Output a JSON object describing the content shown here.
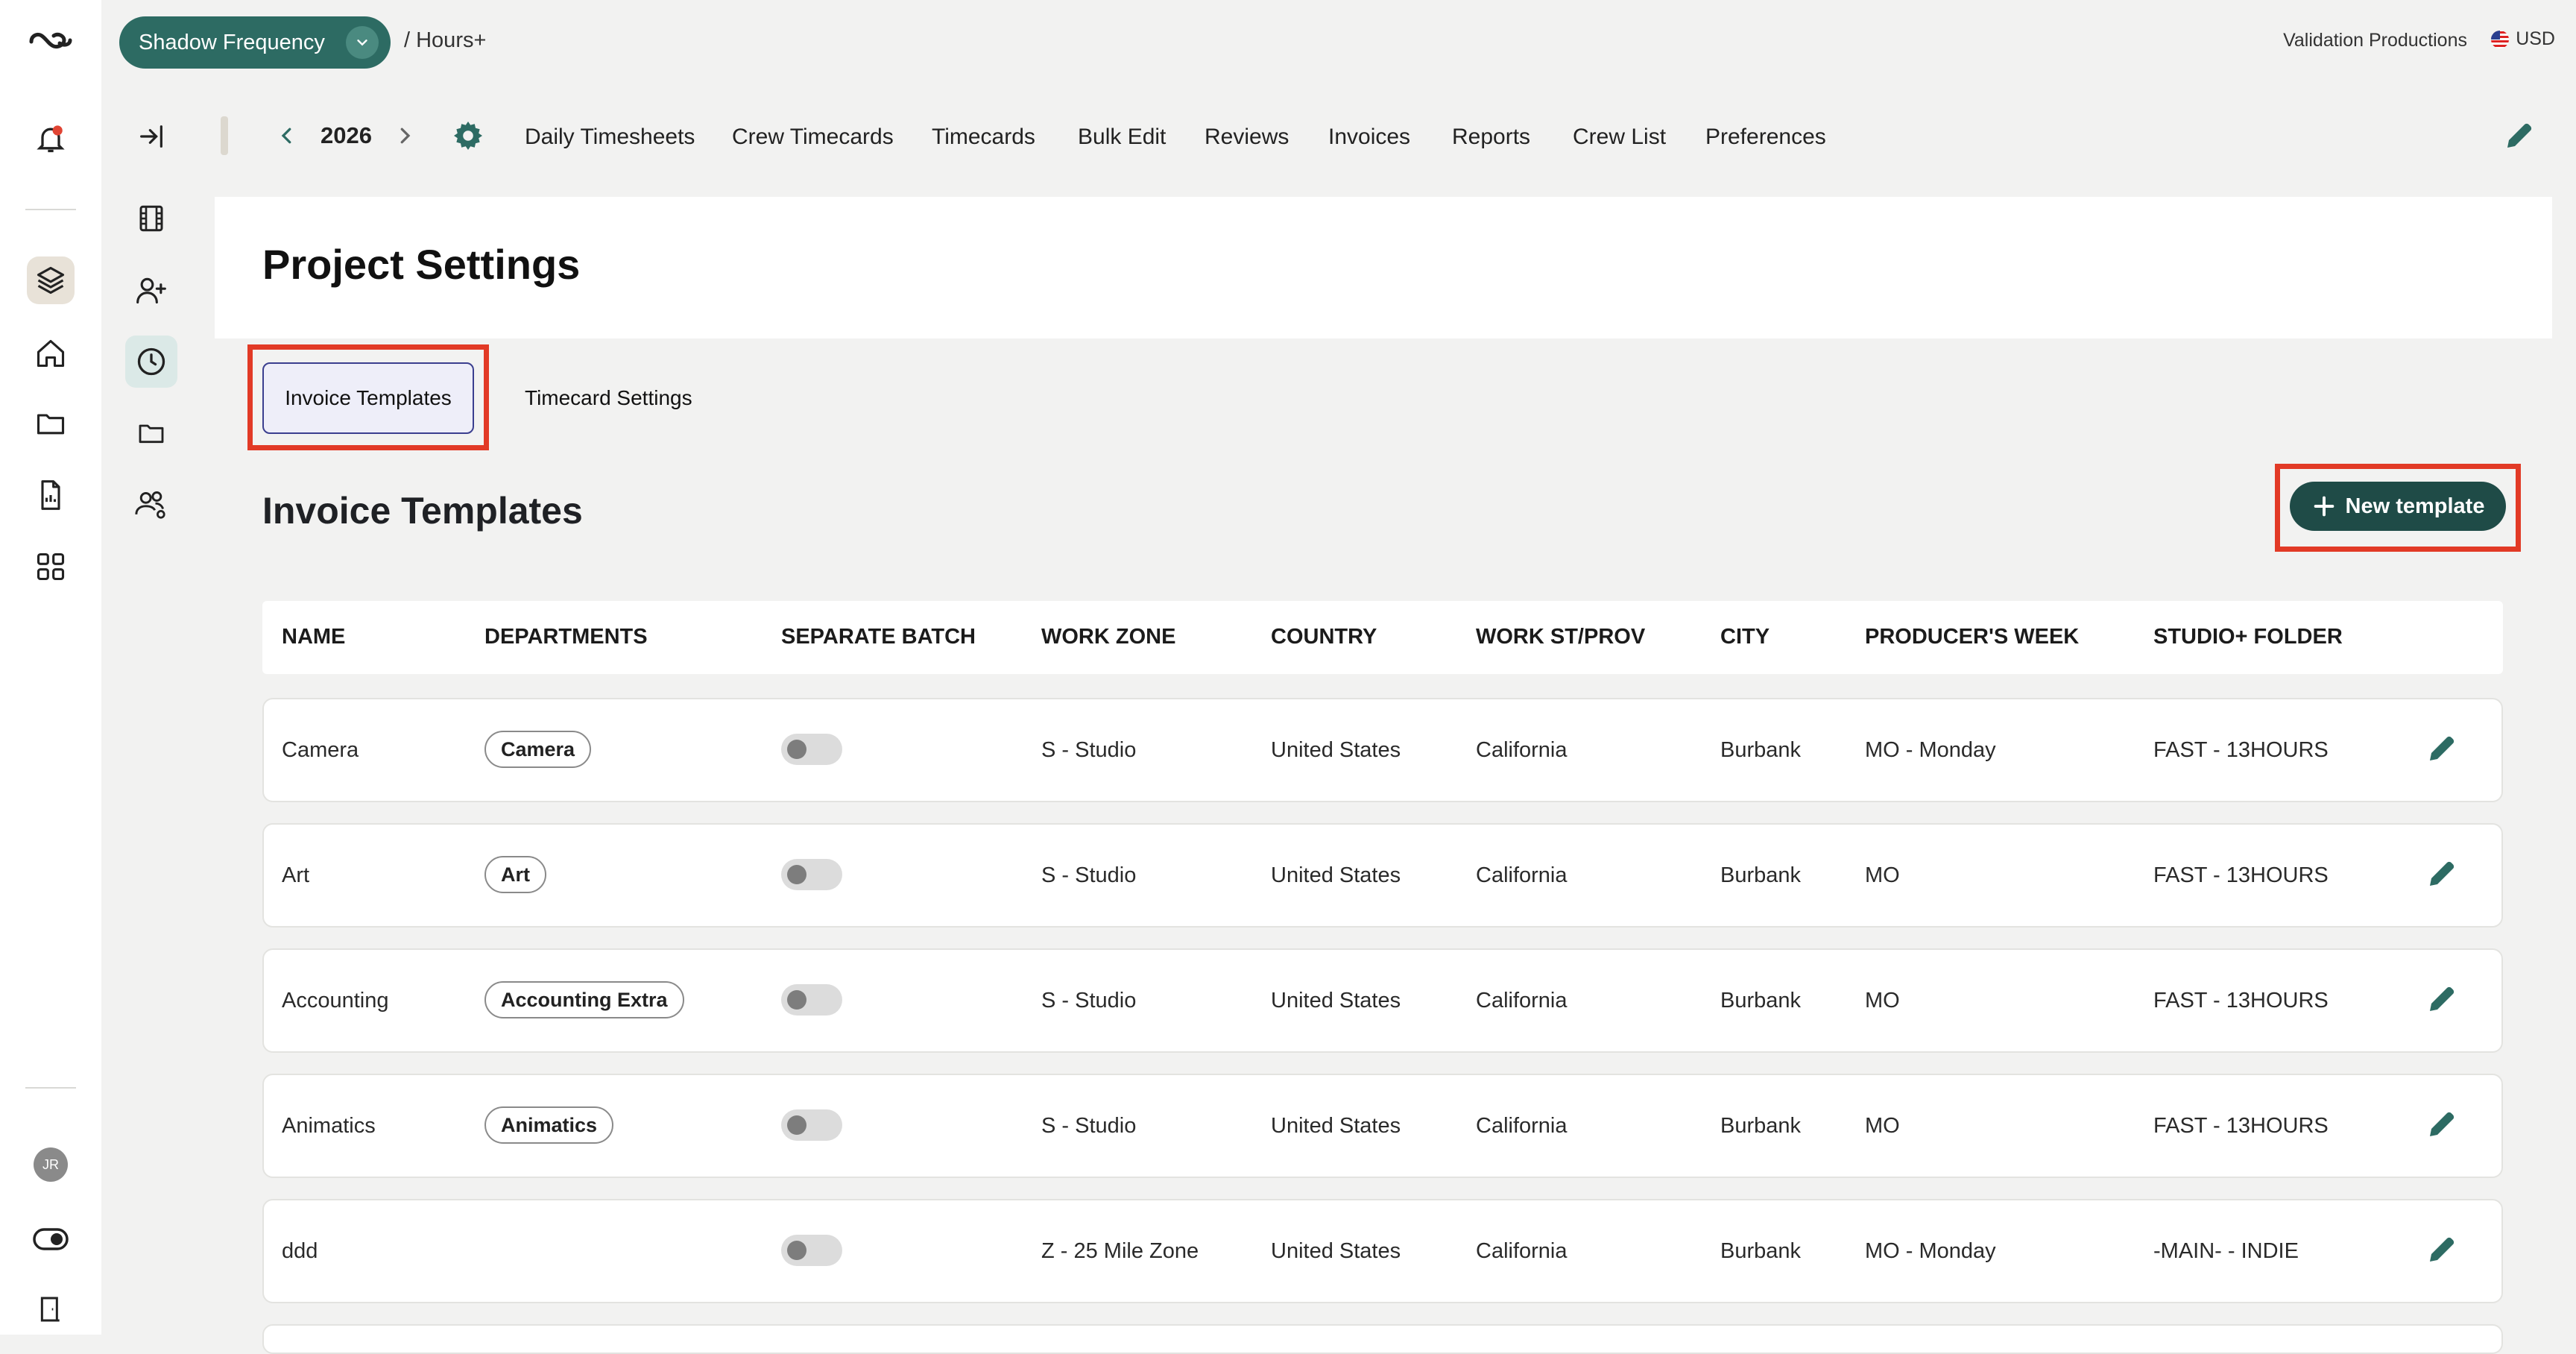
{
  "app": {
    "project_name": "Shadow Frequency",
    "breadcrumb": "/ Hours+",
    "organization": "Validation Productions",
    "currency": "USD"
  },
  "nav": {
    "year": "2026",
    "items": [
      "Daily Timesheets",
      "Crew Timecards",
      "Timecards",
      "Bulk Edit",
      "Reviews",
      "Invoices",
      "Reports",
      "Crew List",
      "Preferences"
    ]
  },
  "rail": {
    "avatar_initials": "JR"
  },
  "page": {
    "title": "Project Settings",
    "tabs": [
      "Invoice Templates",
      "Timecard Settings"
    ],
    "section_title": "Invoice Templates",
    "new_button": "New template"
  },
  "table": {
    "headers": [
      "NAME",
      "DEPARTMENTS",
      "SEPARATE BATCH",
      "WORK ZONE",
      "COUNTRY",
      "WORK ST/PROV",
      "CITY",
      "PRODUCER'S WEEK",
      "STUDIO+ FOLDER"
    ],
    "rows": [
      {
        "name": "Camera",
        "department": "Camera",
        "separate_batch": false,
        "work_zone": "S - Studio",
        "country": "United States",
        "state": "California",
        "city": "Burbank",
        "producers_week": "MO - Monday",
        "folder": "FAST - 13HOURS"
      },
      {
        "name": "Art",
        "department": "Art",
        "separate_batch": false,
        "work_zone": "S - Studio",
        "country": "United States",
        "state": "California",
        "city": "Burbank",
        "producers_week": "MO",
        "folder": "FAST - 13HOURS"
      },
      {
        "name": "Accounting",
        "department": "Accounting Extra",
        "separate_batch": false,
        "work_zone": "S - Studio",
        "country": "United States",
        "state": "California",
        "city": "Burbank",
        "producers_week": "MO",
        "folder": "FAST - 13HOURS"
      },
      {
        "name": "Animatics",
        "department": "Animatics",
        "separate_batch": false,
        "work_zone": "S - Studio",
        "country": "United States",
        "state": "California",
        "city": "Burbank",
        "producers_week": "MO",
        "folder": "FAST - 13HOURS"
      },
      {
        "name": "ddd",
        "department": "",
        "separate_batch": false,
        "work_zone": "Z - 25 Mile Zone",
        "country": "United States",
        "state": "California",
        "city": "Burbank",
        "producers_week": "MO - Monday",
        "folder": "-MAIN- - INDIE"
      }
    ]
  },
  "colors": {
    "brand": "#2d6b63",
    "button": "#1f4b47",
    "highlight": "#e23a26",
    "tab_border": "#3b3f8f"
  }
}
